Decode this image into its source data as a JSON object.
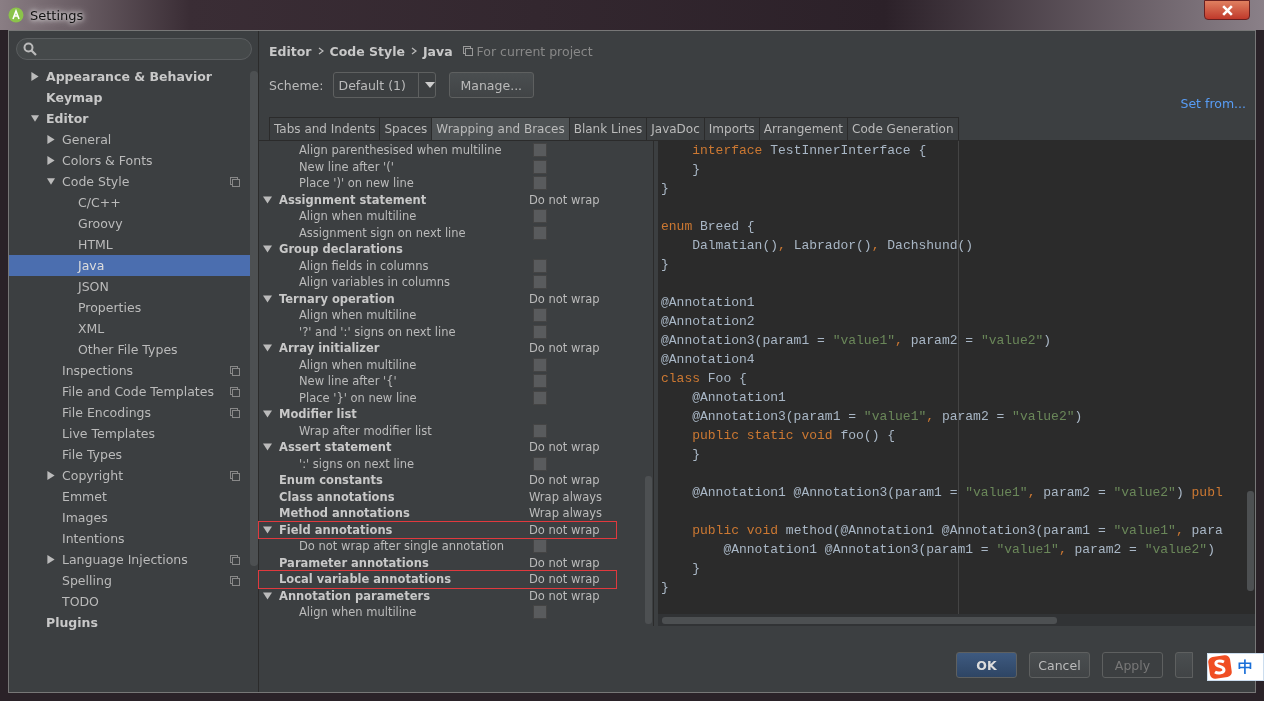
{
  "window": {
    "title": "Settings"
  },
  "sidebar": {
    "items": [
      {
        "label": "Appearance & Behavior",
        "kind": "folder",
        "expanded": false,
        "selected": false,
        "project_icon": false
      },
      {
        "label": "Keymap",
        "kind": "leaf",
        "selected": false,
        "project_icon": false
      },
      {
        "label": "Editor",
        "kind": "folder",
        "expanded": true,
        "selected": false,
        "project_icon": false,
        "children": [
          {
            "label": "General",
            "kind": "folder",
            "expanded": false,
            "selected": false,
            "project_icon": false
          },
          {
            "label": "Colors & Fonts",
            "kind": "folder",
            "expanded": false,
            "selected": false,
            "project_icon": false
          },
          {
            "label": "Code Style",
            "kind": "folder",
            "expanded": true,
            "selected": false,
            "project_icon": true,
            "children": [
              {
                "label": "C/C++",
                "kind": "leaf",
                "selected": false,
                "project_icon": false
              },
              {
                "label": "Groovy",
                "kind": "leaf",
                "selected": false,
                "project_icon": false
              },
              {
                "label": "HTML",
                "kind": "leaf",
                "selected": false,
                "project_icon": false
              },
              {
                "label": "Java",
                "kind": "leaf",
                "selected": true,
                "project_icon": false
              },
              {
                "label": "JSON",
                "kind": "leaf",
                "selected": false,
                "project_icon": false
              },
              {
                "label": "Properties",
                "kind": "leaf",
                "selected": false,
                "project_icon": false
              },
              {
                "label": "XML",
                "kind": "leaf",
                "selected": false,
                "project_icon": false
              },
              {
                "label": "Other File Types",
                "kind": "leaf",
                "selected": false,
                "project_icon": false
              }
            ]
          },
          {
            "label": "Inspections",
            "kind": "leaf",
            "selected": false,
            "project_icon": true
          },
          {
            "label": "File and Code Templates",
            "kind": "leaf",
            "selected": false,
            "project_icon": true
          },
          {
            "label": "File Encodings",
            "kind": "leaf",
            "selected": false,
            "project_icon": true
          },
          {
            "label": "Live Templates",
            "kind": "leaf",
            "selected": false,
            "project_icon": false
          },
          {
            "label": "File Types",
            "kind": "leaf",
            "selected": false,
            "project_icon": false
          },
          {
            "label": "Copyright",
            "kind": "folder",
            "expanded": false,
            "selected": false,
            "project_icon": true
          },
          {
            "label": "Emmet",
            "kind": "leaf",
            "selected": false,
            "project_icon": false
          },
          {
            "label": "Images",
            "kind": "leaf",
            "selected": false,
            "project_icon": false
          },
          {
            "label": "Intentions",
            "kind": "leaf",
            "selected": false,
            "project_icon": false
          },
          {
            "label": "Language Injections",
            "kind": "folder",
            "expanded": false,
            "selected": false,
            "project_icon": true
          },
          {
            "label": "Spelling",
            "kind": "leaf",
            "selected": false,
            "project_icon": true
          },
          {
            "label": "TODO",
            "kind": "leaf",
            "selected": false,
            "project_icon": false
          }
        ]
      },
      {
        "label": "Plugins",
        "kind": "leaf",
        "selected": false,
        "project_icon": false
      }
    ]
  },
  "breadcrumb": {
    "items": [
      "Editor",
      "Code Style",
      "Java"
    ],
    "scope": "For current project"
  },
  "scheme": {
    "label": "Scheme:",
    "value": "Default (1)",
    "manage": "Manage...",
    "set_from": "Set from..."
  },
  "tabs": [
    {
      "label": "Tabs and Indents",
      "selected": false
    },
    {
      "label": "Spaces",
      "selected": false
    },
    {
      "label": "Wrapping and Braces",
      "selected": true
    },
    {
      "label": "Blank Lines",
      "selected": false
    },
    {
      "label": "JavaDoc",
      "selected": false
    },
    {
      "label": "Imports",
      "selected": false
    },
    {
      "label": "Arrangement",
      "selected": false
    },
    {
      "label": "Code Generation",
      "selected": false
    }
  ],
  "options": [
    {
      "kind": "option",
      "label": "Align parenthesised when multiline",
      "checked": false,
      "highlighted": false
    },
    {
      "kind": "option",
      "label": "New line after '('",
      "checked": false,
      "highlighted": false
    },
    {
      "kind": "option",
      "label": "Place ')' on new line",
      "checked": false,
      "highlighted": false
    },
    {
      "kind": "group",
      "label": "Assignment statement",
      "expanded": true,
      "value": "Do not wrap",
      "highlighted": false
    },
    {
      "kind": "option",
      "label": "Align when multiline",
      "checked": false,
      "highlighted": false
    },
    {
      "kind": "option",
      "label": "Assignment sign on next line",
      "checked": false,
      "highlighted": false
    },
    {
      "kind": "group",
      "label": "Group declarations",
      "expanded": true,
      "highlighted": false
    },
    {
      "kind": "option",
      "label": "Align fields in columns",
      "checked": false,
      "highlighted": false
    },
    {
      "kind": "option",
      "label": "Align variables in columns",
      "checked": false,
      "highlighted": false
    },
    {
      "kind": "group",
      "label": "Ternary operation",
      "expanded": true,
      "value": "Do not wrap",
      "highlighted": false
    },
    {
      "kind": "option",
      "label": "Align when multiline",
      "checked": false,
      "highlighted": false
    },
    {
      "kind": "option",
      "label": "'?' and ':' signs on next line",
      "checked": false,
      "highlighted": false
    },
    {
      "kind": "group",
      "label": "Array initializer",
      "expanded": true,
      "value": "Do not wrap",
      "highlighted": false
    },
    {
      "kind": "option",
      "label": "Align when multiline",
      "checked": false,
      "highlighted": false
    },
    {
      "kind": "option",
      "label": "New line after '{'",
      "checked": false,
      "highlighted": false
    },
    {
      "kind": "option",
      "label": "Place '}' on new line",
      "checked": false,
      "highlighted": false
    },
    {
      "kind": "group",
      "label": "Modifier list",
      "expanded": true,
      "highlighted": false
    },
    {
      "kind": "option",
      "label": "Wrap after modifier list",
      "checked": false,
      "highlighted": false
    },
    {
      "kind": "group",
      "label": "Assert statement",
      "expanded": true,
      "value": "Do not wrap",
      "highlighted": false
    },
    {
      "kind": "option",
      "label": "':' signs on next line",
      "checked": false,
      "highlighted": false
    },
    {
      "kind": "setting",
      "label": "Enum constants",
      "value": "Do not wrap",
      "highlighted": false
    },
    {
      "kind": "setting",
      "label": "Class annotations",
      "value": "Wrap always",
      "highlighted": false
    },
    {
      "kind": "setting",
      "label": "Method annotations",
      "value": "Wrap always",
      "highlighted": false
    },
    {
      "kind": "group",
      "label": "Field annotations",
      "expanded": true,
      "value": "Do not wrap",
      "highlighted": true
    },
    {
      "kind": "option",
      "label": "Do not wrap after single annotation",
      "checked": false,
      "highlighted": false
    },
    {
      "kind": "setting",
      "label": "Parameter annotations",
      "value": "Do not wrap",
      "highlighted": false
    },
    {
      "kind": "setting",
      "label": "Local variable annotations",
      "value": "Do not wrap",
      "highlighted": true
    },
    {
      "kind": "group",
      "label": "Annotation parameters",
      "expanded": true,
      "value": "Do not wrap",
      "highlighted": false
    },
    {
      "kind": "option",
      "label": "Align when multiline",
      "checked": false,
      "highlighted": false
    }
  ],
  "code_lines": [
    {
      "kind": "code",
      "tokens": [
        {
          "kind": "keyword",
          "text": "    interface"
        },
        {
          "kind": "plain",
          "text": " TestInnerInterface {"
        }
      ]
    },
    {
      "kind": "code",
      "tokens": [
        {
          "kind": "plain",
          "text": "    }"
        }
      ]
    },
    {
      "kind": "code",
      "tokens": [
        {
          "kind": "plain",
          "text": "}"
        }
      ]
    },
    {
      "kind": "blank"
    },
    {
      "kind": "code",
      "tokens": [
        {
          "kind": "keyword",
          "text": "enum"
        },
        {
          "kind": "plain",
          "text": " Breed {"
        }
      ]
    },
    {
      "kind": "code",
      "tokens": [
        {
          "kind": "plain",
          "text": "    Dalmatian()"
        },
        {
          "kind": "keyword",
          "text": ","
        },
        {
          "kind": "plain",
          "text": " Labrador()"
        },
        {
          "kind": "keyword",
          "text": ","
        },
        {
          "kind": "plain",
          "text": " Dachshund()"
        }
      ]
    },
    {
      "kind": "code",
      "tokens": [
        {
          "kind": "plain",
          "text": "}"
        }
      ]
    },
    {
      "kind": "blank"
    },
    {
      "kind": "code",
      "tokens": [
        {
          "kind": "plain",
          "text": "@Annotation1"
        }
      ]
    },
    {
      "kind": "code",
      "tokens": [
        {
          "kind": "plain",
          "text": "@Annotation2"
        }
      ]
    },
    {
      "kind": "code",
      "tokens": [
        {
          "kind": "plain",
          "text": "@Annotation3(param1 = "
        },
        {
          "kind": "string",
          "text": "\"value1\""
        },
        {
          "kind": "keyword",
          "text": ","
        },
        {
          "kind": "plain",
          "text": " param2 = "
        },
        {
          "kind": "string",
          "text": "\"value2\""
        },
        {
          "kind": "plain",
          "text": ")"
        }
      ]
    },
    {
      "kind": "code",
      "tokens": [
        {
          "kind": "plain",
          "text": "@Annotation4"
        }
      ]
    },
    {
      "kind": "code",
      "tokens": [
        {
          "kind": "keyword",
          "text": "class"
        },
        {
          "kind": "plain",
          "text": " Foo {"
        }
      ]
    },
    {
      "kind": "code",
      "tokens": [
        {
          "kind": "plain",
          "text": "    @Annotation1"
        }
      ]
    },
    {
      "kind": "code",
      "tokens": [
        {
          "kind": "plain",
          "text": "    @Annotation3(param1 = "
        },
        {
          "kind": "string",
          "text": "\"value1\""
        },
        {
          "kind": "keyword",
          "text": ","
        },
        {
          "kind": "plain",
          "text": " param2 = "
        },
        {
          "kind": "string",
          "text": "\"value2\""
        },
        {
          "kind": "plain",
          "text": ")"
        }
      ]
    },
    {
      "kind": "code",
      "tokens": [
        {
          "kind": "keyword",
          "text": "    public static void"
        },
        {
          "kind": "plain",
          "text": " foo() {"
        }
      ]
    },
    {
      "kind": "code",
      "tokens": [
        {
          "kind": "plain",
          "text": "    }"
        }
      ]
    },
    {
      "kind": "blank"
    },
    {
      "kind": "code",
      "tokens": [
        {
          "kind": "plain",
          "text": "    @Annotation1 @Annotation3(param1 = "
        },
        {
          "kind": "string",
          "text": "\"value1\""
        },
        {
          "kind": "keyword",
          "text": ","
        },
        {
          "kind": "plain",
          "text": " param2 = "
        },
        {
          "kind": "string",
          "text": "\"value2\""
        },
        {
          "kind": "plain",
          "text": ") "
        },
        {
          "kind": "keyword",
          "text": "publ"
        }
      ]
    },
    {
      "kind": "blank"
    },
    {
      "kind": "code",
      "tokens": [
        {
          "kind": "keyword",
          "text": "    public void"
        },
        {
          "kind": "plain",
          "text": " method(@Annotation1 @Annotation3(param1 = "
        },
        {
          "kind": "string",
          "text": "\"value1\""
        },
        {
          "kind": "keyword",
          "text": ","
        },
        {
          "kind": "plain",
          "text": " para"
        }
      ]
    },
    {
      "kind": "code",
      "tokens": [
        {
          "kind": "plain",
          "text": "        @Annotation1 @Annotation3(param1 = "
        },
        {
          "kind": "string",
          "text": "\"value1\""
        },
        {
          "kind": "keyword",
          "text": ","
        },
        {
          "kind": "plain",
          "text": " param2 = "
        },
        {
          "kind": "string",
          "text": "\"value2\""
        },
        {
          "kind": "plain",
          "text": ")"
        }
      ]
    },
    {
      "kind": "code",
      "tokens": [
        {
          "kind": "plain",
          "text": "    }"
        }
      ]
    },
    {
      "kind": "code",
      "tokens": [
        {
          "kind": "plain",
          "text": "}"
        }
      ]
    }
  ],
  "buttons": [
    {
      "label": "OK",
      "primary": true,
      "disabled": false
    },
    {
      "label": "Cancel",
      "primary": false,
      "disabled": false
    },
    {
      "label": "Apply",
      "primary": false,
      "disabled": true
    },
    {
      "primary": false,
      "disabled": false
    }
  ],
  "ime_bar": {
    "label": "中"
  }
}
